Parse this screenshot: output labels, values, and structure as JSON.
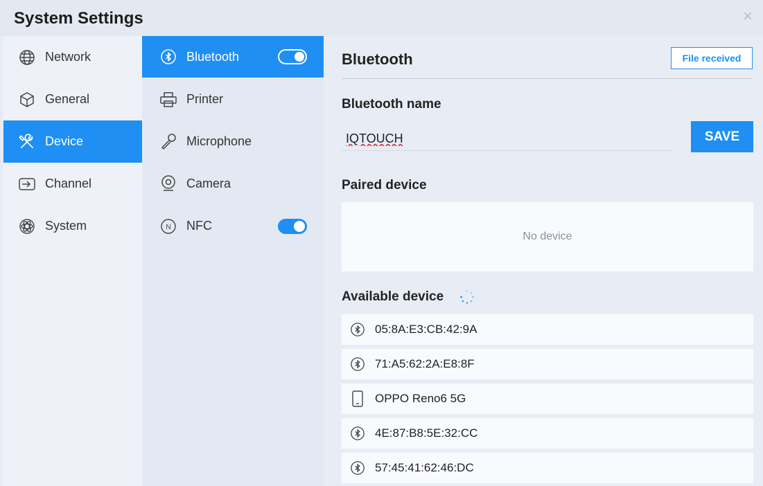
{
  "window": {
    "title": "System Settings"
  },
  "nav_main": {
    "items": [
      {
        "label": "Network",
        "icon": "globe-icon"
      },
      {
        "label": "General",
        "icon": "cube-icon"
      },
      {
        "label": "Device",
        "icon": "tools-icon",
        "active": true
      },
      {
        "label": "Channel",
        "icon": "input-source-icon"
      },
      {
        "label": "System",
        "icon": "atom-icon"
      }
    ]
  },
  "nav_device": {
    "items": [
      {
        "label": "Bluetooth",
        "icon": "bluetooth-icon",
        "active": true,
        "toggle": "on"
      },
      {
        "label": "Printer",
        "icon": "printer-icon"
      },
      {
        "label": "Microphone",
        "icon": "microphone-icon"
      },
      {
        "label": "Camera",
        "icon": "camera-icon"
      },
      {
        "label": "NFC",
        "icon": "nfc-icon",
        "toggle": "on"
      }
    ]
  },
  "bluetooth": {
    "title": "Bluetooth",
    "file_received_label": "File received",
    "name_label": "Bluetooth name",
    "name_value": "IQTOUCH",
    "save_label": "SAVE",
    "paired_label": "Paired device",
    "paired_empty": "No device",
    "available_label": "Available device",
    "available_devices": [
      {
        "name": "05:8A:E3:CB:42:9A",
        "icon": "bluetooth-icon"
      },
      {
        "name": "71:A5:62:2A:E8:8F",
        "icon": "bluetooth-icon"
      },
      {
        "name": "OPPO Reno6 5G",
        "icon": "phone-icon"
      },
      {
        "name": "4E:87:B8:5E:32:CC",
        "icon": "bluetooth-icon"
      },
      {
        "name": "57:45:41:62:46:DC",
        "icon": "bluetooth-icon"
      }
    ]
  },
  "colors": {
    "accent": "#1f8ff3",
    "bg": "#e8edf5"
  }
}
